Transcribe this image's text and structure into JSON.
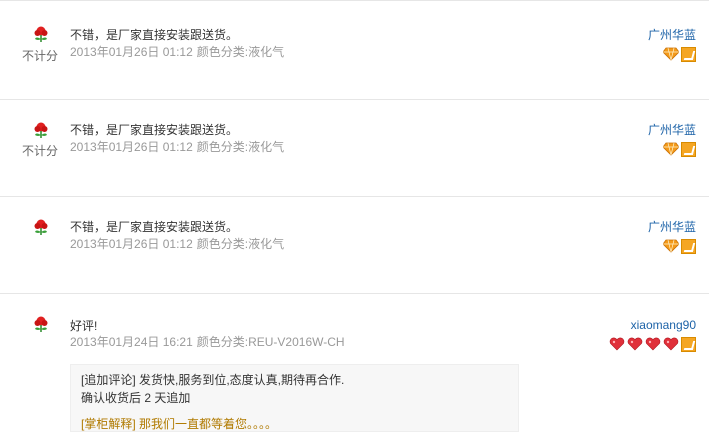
{
  "reviews": [
    {
      "score_label": "不计分",
      "content": "不错，是厂家直接安装跟送货。",
      "date": "2013年01月26日 01:12",
      "category": "颜色分类:液化气",
      "buyer": "广州华蓝",
      "badges": [
        "diamond-icon",
        "vip-icon"
      ]
    },
    {
      "score_label": "不计分",
      "content": "不错，是厂家直接安装跟送货。",
      "date": "2013年01月26日 01:12",
      "category": "颜色分类:液化气",
      "buyer": "广州华蓝",
      "badges": [
        "diamond-icon",
        "vip-icon"
      ]
    },
    {
      "score_label": "",
      "content": "不错，是厂家直接安装跟送货。",
      "date": "2013年01月26日 01:12",
      "category": "颜色分类:液化气",
      "buyer": "广州华蓝",
      "badges": [
        "diamond-icon",
        "vip-icon"
      ]
    },
    {
      "score_label": "",
      "content": "好评!",
      "date": "2013年01月24日 16:21",
      "category": "颜色分类:REU-V2016W-CH",
      "buyer": "xiaomang90",
      "badges": [
        "heart-icon",
        "heart-icon",
        "heart-icon",
        "heart-icon",
        "vip-icon"
      ],
      "append": {
        "label": "[追加评论]",
        "text": "发货快,服务到位,态度认真,期待再合作.",
        "confirm": "确认收货后 2 天追加",
        "reply_label": "[掌柜解释]",
        "reply_text": "那我们一直都等着您。。。。"
      }
    }
  ],
  "colors": {
    "buyer_link": "#1d63a8",
    "meta_gray": "#999999",
    "reply": "#b07a00"
  }
}
